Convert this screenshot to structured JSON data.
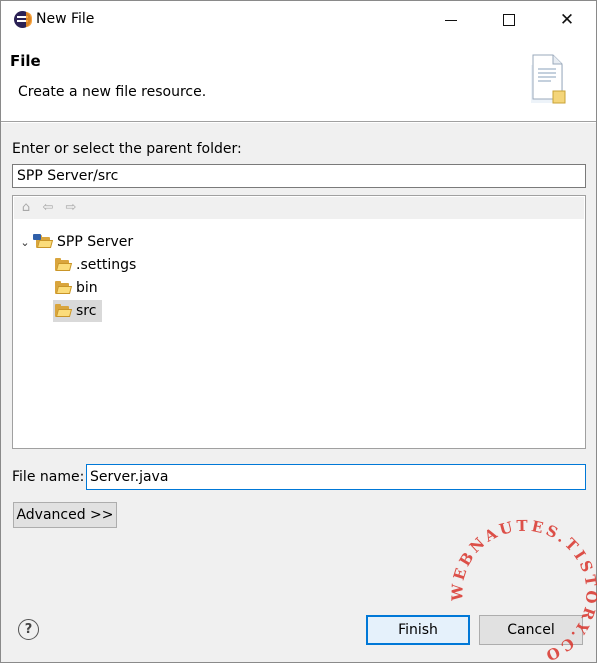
{
  "window": {
    "title": "New File"
  },
  "banner": {
    "title": "File",
    "description": "Create a new file resource."
  },
  "parent_folder": {
    "label": "Enter or select the parent folder:",
    "value": "SPP Server/src"
  },
  "tree": {
    "project": {
      "label": "SPP Server"
    },
    "children": [
      {
        "label": ".settings"
      },
      {
        "label": "bin"
      },
      {
        "label": "src",
        "selected": true
      }
    ]
  },
  "file_name": {
    "label": "File name:",
    "value": "Server.java"
  },
  "buttons": {
    "advanced": "Advanced >>",
    "finish": "Finish",
    "cancel": "Cancel"
  },
  "watermark": {
    "text": "WEBNAUTES.TISTORY.COM"
  },
  "colors": {
    "accent": "#0078d7",
    "dialog_bg": "#f0f0f0",
    "watermark": "#d9342b"
  }
}
